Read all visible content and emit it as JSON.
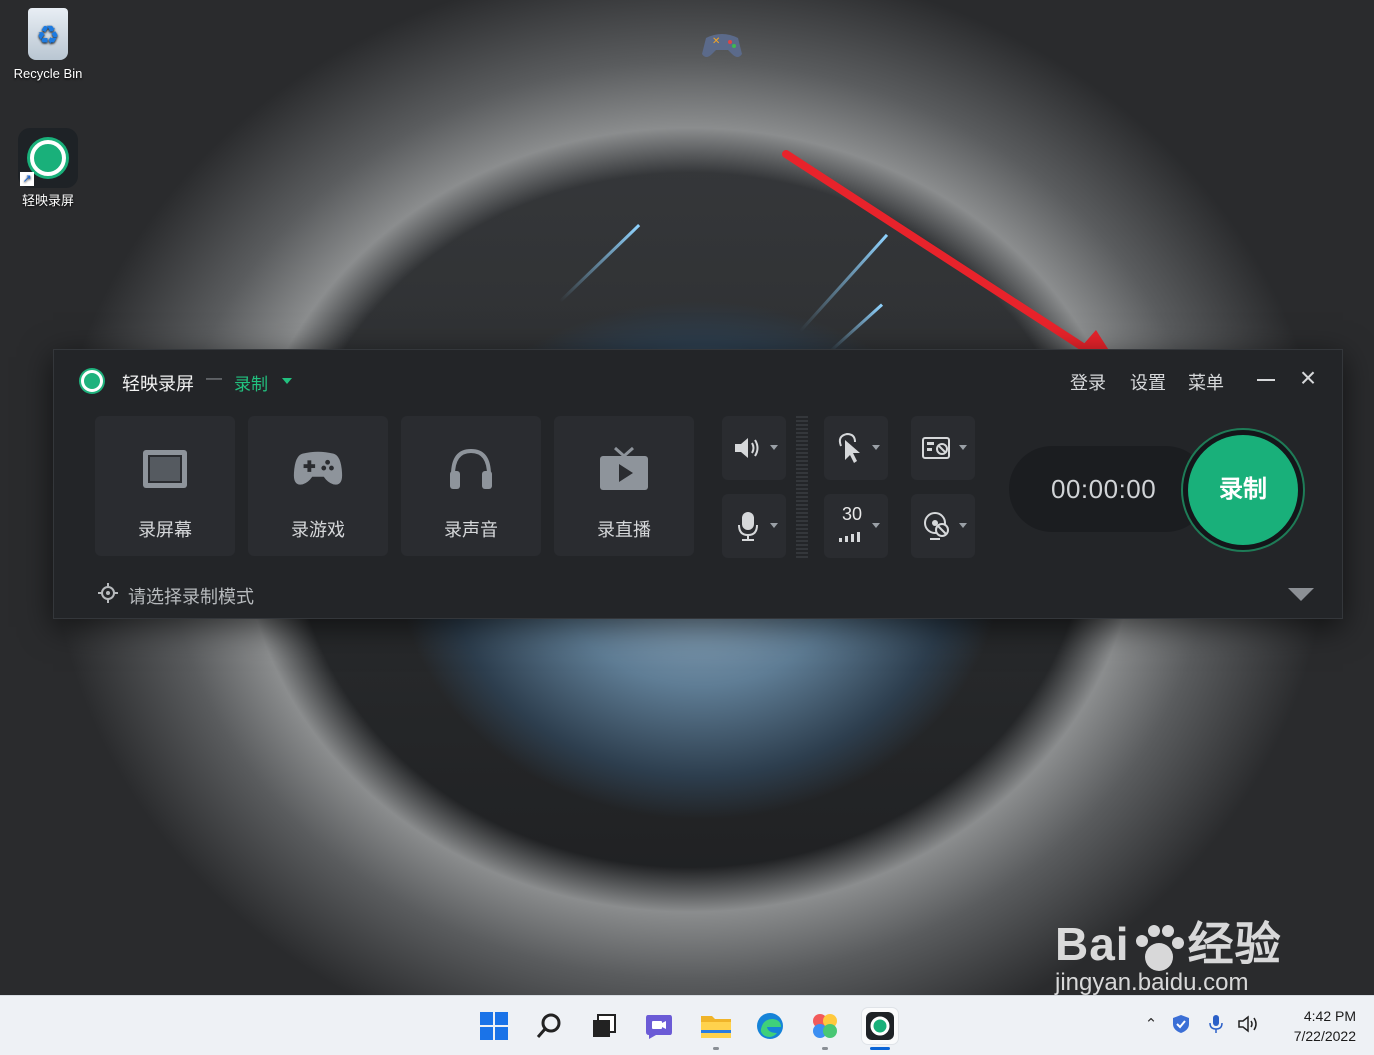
{
  "desktop": {
    "icons": [
      {
        "label": "Recycle Bin",
        "icon": "recycle-bin-icon"
      },
      {
        "label": "轻映录屏",
        "icon": "app-ring-icon"
      }
    ]
  },
  "window": {
    "app_name": "轻映录屏",
    "separator": "—",
    "mode_label": "录制",
    "header_links": {
      "login": "登录",
      "settings": "设置",
      "menu": "菜单"
    },
    "modes": [
      {
        "label": "录屏幕",
        "icon": "screen-icon"
      },
      {
        "label": "录游戏",
        "icon": "gamepad-icon"
      },
      {
        "label": "录声音",
        "icon": "headphones-icon"
      },
      {
        "label": "录直播",
        "icon": "tv-play-icon"
      }
    ],
    "controls": {
      "speaker": "speaker-icon",
      "microphone": "microphone-icon",
      "cursor": "cursor-click-icon",
      "fps": "30",
      "camera_overlay": "camera-off-icon",
      "webcam": "webcam-off-icon"
    },
    "timer": "00:00:00",
    "record_button": "录制",
    "hint": "请选择录制模式"
  },
  "taskbar": {
    "apps": [
      "windows-start-icon",
      "search-icon",
      "task-view-icon",
      "chat-icon",
      "file-explorer-icon",
      "edge-icon",
      "photos-icon",
      "recorder-app-icon"
    ],
    "clock": {
      "time": "4:42 PM",
      "date": "7/22/2022"
    }
  },
  "watermark": {
    "brand": "Bai",
    "brand_suffix": "经验",
    "url": "jingyan.baidu.com"
  },
  "colors": {
    "accent": "#19b07a",
    "window_bg": "#232528",
    "arrow": "#e8232b"
  }
}
